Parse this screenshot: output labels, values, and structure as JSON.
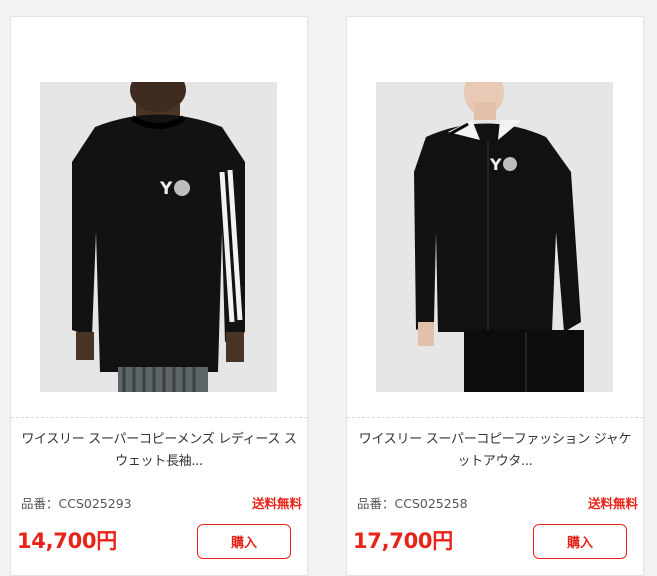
{
  "products": [
    {
      "title": "ワイスリー スーパーコピーメンズ レディース スウェット長袖...",
      "sku": "品番：CCS025293",
      "shipping": "送料無料",
      "price": "14,700円",
      "buy_label": "購入",
      "logo_text": "Y"
    },
    {
      "title": "ワイスリー スーパーコピーファッション ジャケットアウタ...",
      "sku": "品番：CCS025258",
      "shipping": "送料無料",
      "price": "17,700円",
      "buy_label": "購入",
      "logo_text": "Y"
    }
  ],
  "colors": {
    "accent": "#e8231a",
    "garment": "#111111",
    "photo_bg": "#e4e4e4"
  }
}
